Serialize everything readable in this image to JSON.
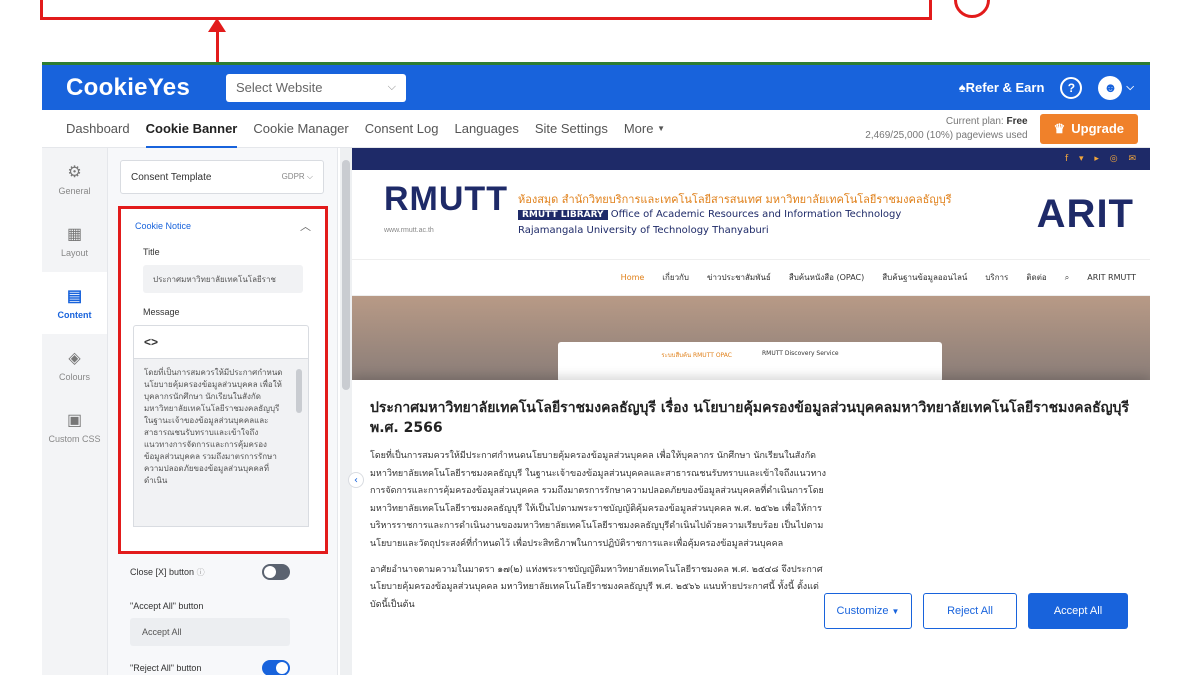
{
  "app": {
    "brand": "CookieYes",
    "site_select_placeholder": "Select Website",
    "refer_label": "Refer & Earn",
    "help_icon": "help-icon",
    "avatar_icon": "user-icon"
  },
  "nav": {
    "tabs": [
      "Dashboard",
      "Cookie Banner",
      "Cookie Manager",
      "Consent Log",
      "Languages",
      "Site Settings",
      "More"
    ],
    "active_tab": "Cookie Banner",
    "plan_label": "Current plan:",
    "plan_value": "Free",
    "pageviews": "2,469/25,000 (10%) pageviews used",
    "upgrade_label": "Upgrade"
  },
  "rail": {
    "items": [
      "General",
      "Layout",
      "Content",
      "Colours",
      "Custom CSS"
    ],
    "active": "Content"
  },
  "panel": {
    "template_label": "Consent Template",
    "template_value": "GDPR",
    "section_title": "Cookie Notice",
    "title_label": "Title",
    "title_value": "ประกาศมหาวิทยาลัยเทคโนโลยีราช",
    "message_label": "Message",
    "message_toolbar": "<>",
    "message_value": "โดยที่เป็นการสมควรให้มีประกาศกำหนดนโยบายคุ้มครองข้อมูลส่วนบุคคล เพื่อให้บุคลากรนักศึกษา นักเรียนในสังกัดมหาวิทยาลัยเทคโนโลยีราชมงคลธัญบุรี ในฐานะเจ้าของข้อมูลส่วนบุคคลและสาธารณชนรับทราบและเข้าใจถึงแนวทางการจัดการและการคุ้มครองข้อมูลส่วนบุคคล รวมถึงมาตรการรักษาความปลอดภัยของข้อมูลส่วนบุคคลที่ดำเนิน",
    "close_button_label": "Close [X] button",
    "accept_all_label": "\"Accept All\" button",
    "accept_all_value": "Accept All",
    "reject_all_label": "\"Reject All\" button",
    "close_toggle": false,
    "reject_toggle": true
  },
  "preview": {
    "logo": "RMUTT",
    "logo_sub": "www.rmutt.ac.th",
    "library_th": "ห้องสมุด สำนักวิทยบริการและเทคโนโลยีสารสนเทศ มหาวิทยาลัยเทคโนโลยีราชมงคลธัญบุรี",
    "library_badge": "RMUTT LIBRARY",
    "library_en1": "Office of Academic Resources and Information Technology",
    "library_en2": "Rajamangala University of Technology Thanyaburi",
    "arit": "ARIT",
    "menu": [
      "Home",
      "เกี่ยวกับ",
      "ข่าวประชาสัมพันธ์",
      "สืบค้นหนังสือ (OPAC)",
      "สืบค้นฐานข้อมูลออนไลน์",
      "บริการ",
      "ติดต่อ",
      "ARIT RMUTT"
    ],
    "hero_tabs": [
      "ระบบสืบค้น RMUTT OPAC",
      "RMUTT Discovery Service"
    ],
    "social_icons": "f ▾ ▸ ◎ ✉"
  },
  "banner": {
    "title": "ประกาศมหาวิทยาลัยเทคโนโลยีราชมงคลธัญบุรี เรื่อง นโยบายคุ้มครองข้อมูลส่วนบุคคลมหาวิทยาลัยเทคโนโลยีราชมงคลธัญบุรี พ.ศ. 2566",
    "para1": "โดยที่เป็นการสมควรให้มีประกาศกำหนดนโยบายคุ้มครองข้อมูลส่วนบุคคล เพื่อให้บุคลากร นักศึกษา นักเรียนในสังกัดมหาวิทยาลัยเทคโนโลยีราชมงคลธัญบุรี ในฐานะเจ้าของข้อมูลส่วนบุคคลและสาธารณชนรับทราบและเข้าใจถึงแนวทางการจัดการและการคุ้มครองข้อมูลส่วนบุคคล รวมถึงมาตรการรักษาความปลอดภัยของข้อมูลส่วนบุคคลที่ดำเนินการโดยมหาวิทยาลัยเทคโนโลยีราชมงคลธัญบุรี ให้เป็นไปตามพระราชบัญญัติคุ้มครองข้อมูลส่วนบุคคล พ.ศ. ๒๕๖๒ เพื่อให้การบริหารราชการและการดำเนินงานของมหาวิทยาลัยเทคโนโลยีราชมงคลธัญบุรีดำเนินไปด้วยความเรียบร้อย เป็นไปตามนโยบายและวัตถุประสงค์ที่กำหนดไว้ เพื่อประสิทธิภาพในการปฏิบัติราชการและเพื่อคุ้มครองข้อมูลส่วนบุคคล",
    "para2": "อาศัยอำนาจตามความในมาตรา ๑๗(๒) แห่งพระราชบัญญัติมหาวิทยาลัยเทคโนโลยีราชมงคล พ.ศ. ๒๕๔๘ จึงประกาศนโยบายคุ้มครองข้อมูลส่วนบุคคล มหาวิทยาลัยเทคโนโลยีราชมงคลธัญบุรี พ.ศ. ๒๕๖๖ แนบท้ายประกาศนี้ ทั้งนี้ ตั้งแต่บัดนี้เป็นต้น",
    "customize_label": "Customize",
    "reject_label": "Reject All",
    "accept_label": "Accept All"
  },
  "colors": {
    "brand_blue": "#1863dc",
    "annotation_red": "#e21b1b",
    "upgrade_orange": "#f0812a"
  }
}
